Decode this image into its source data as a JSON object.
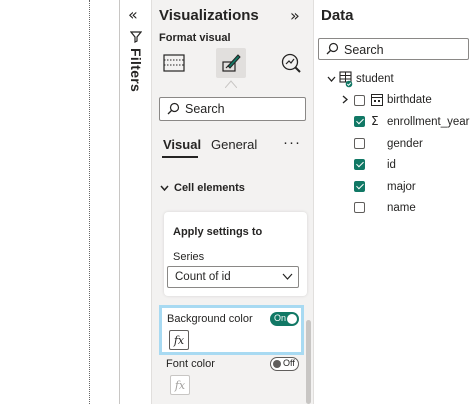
{
  "filters": {
    "label": "Filters"
  },
  "visualizations": {
    "title": "Visualizations",
    "subtitle": "Format visual",
    "search_placeholder": "Search",
    "tabs": [
      "Visual",
      "General"
    ],
    "more": "···",
    "section": "Cell elements",
    "apply_settings": {
      "title": "Apply settings to",
      "series_label": "Series",
      "series_value": "Count of id"
    },
    "background_color": {
      "label": "Background color",
      "toggle": "On",
      "fx": "fx"
    },
    "font_color": {
      "label": "Font color",
      "toggle": "Off",
      "fx": "fx"
    }
  },
  "data": {
    "title": "Data",
    "search_placeholder": "Search",
    "table": "student",
    "fields": [
      {
        "name": "birthdate",
        "checked": false,
        "icon": "calendar-hierarchy-icon"
      },
      {
        "name": "enrollment_year",
        "checked": true,
        "icon": "sigma-icon"
      },
      {
        "name": "gender",
        "checked": false,
        "icon": ""
      },
      {
        "name": "id",
        "checked": true,
        "icon": ""
      },
      {
        "name": "major",
        "checked": true,
        "icon": ""
      },
      {
        "name": "name",
        "checked": false,
        "icon": ""
      }
    ]
  },
  "colors": {
    "accent": "#117865",
    "focus_border": "#a8daf2",
    "pane_bg": "#f3f2f1"
  }
}
